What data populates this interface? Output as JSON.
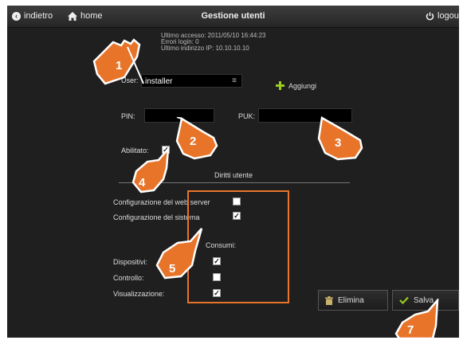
{
  "topbar": {
    "back_label": "indietro",
    "home_label": "home",
    "title": "Gestione utenti",
    "logout_label": "logout"
  },
  "info": {
    "last_access": "Ultimo accesso: 2011/05/10 16:44:23",
    "login_errors": "Errori login: 0",
    "last_ip": "Ultimo indirizzo IP: 10.10.10.10"
  },
  "form": {
    "user_label": "User:",
    "user_value": "installer",
    "add_label": "Aggiungi",
    "pin_label": "PIN:",
    "puk_label": "PUK:",
    "enabled_label": "Abilitato:",
    "enabled_checked": true
  },
  "rights": {
    "heading": "Diritti utente",
    "web_server_label": "Configurazione del web server",
    "web_server_checked": false,
    "system_label": "Configurazione del sistema",
    "system_checked": true,
    "consumption_heading": "Consumi:",
    "devices_label": "Dispositivi:",
    "devices_checked": true,
    "control_label": "Controllo:",
    "control_checked": false,
    "view_label": "Visualizzazione:",
    "view_checked": true
  },
  "buttons": {
    "delete_label": "Elimina",
    "save_label": "Salva"
  },
  "callouts": [
    "1",
    "2",
    "3",
    "4",
    "5",
    "7"
  ],
  "colors": {
    "accent_orange": "#e8742a",
    "add_green": "#99cc22"
  }
}
